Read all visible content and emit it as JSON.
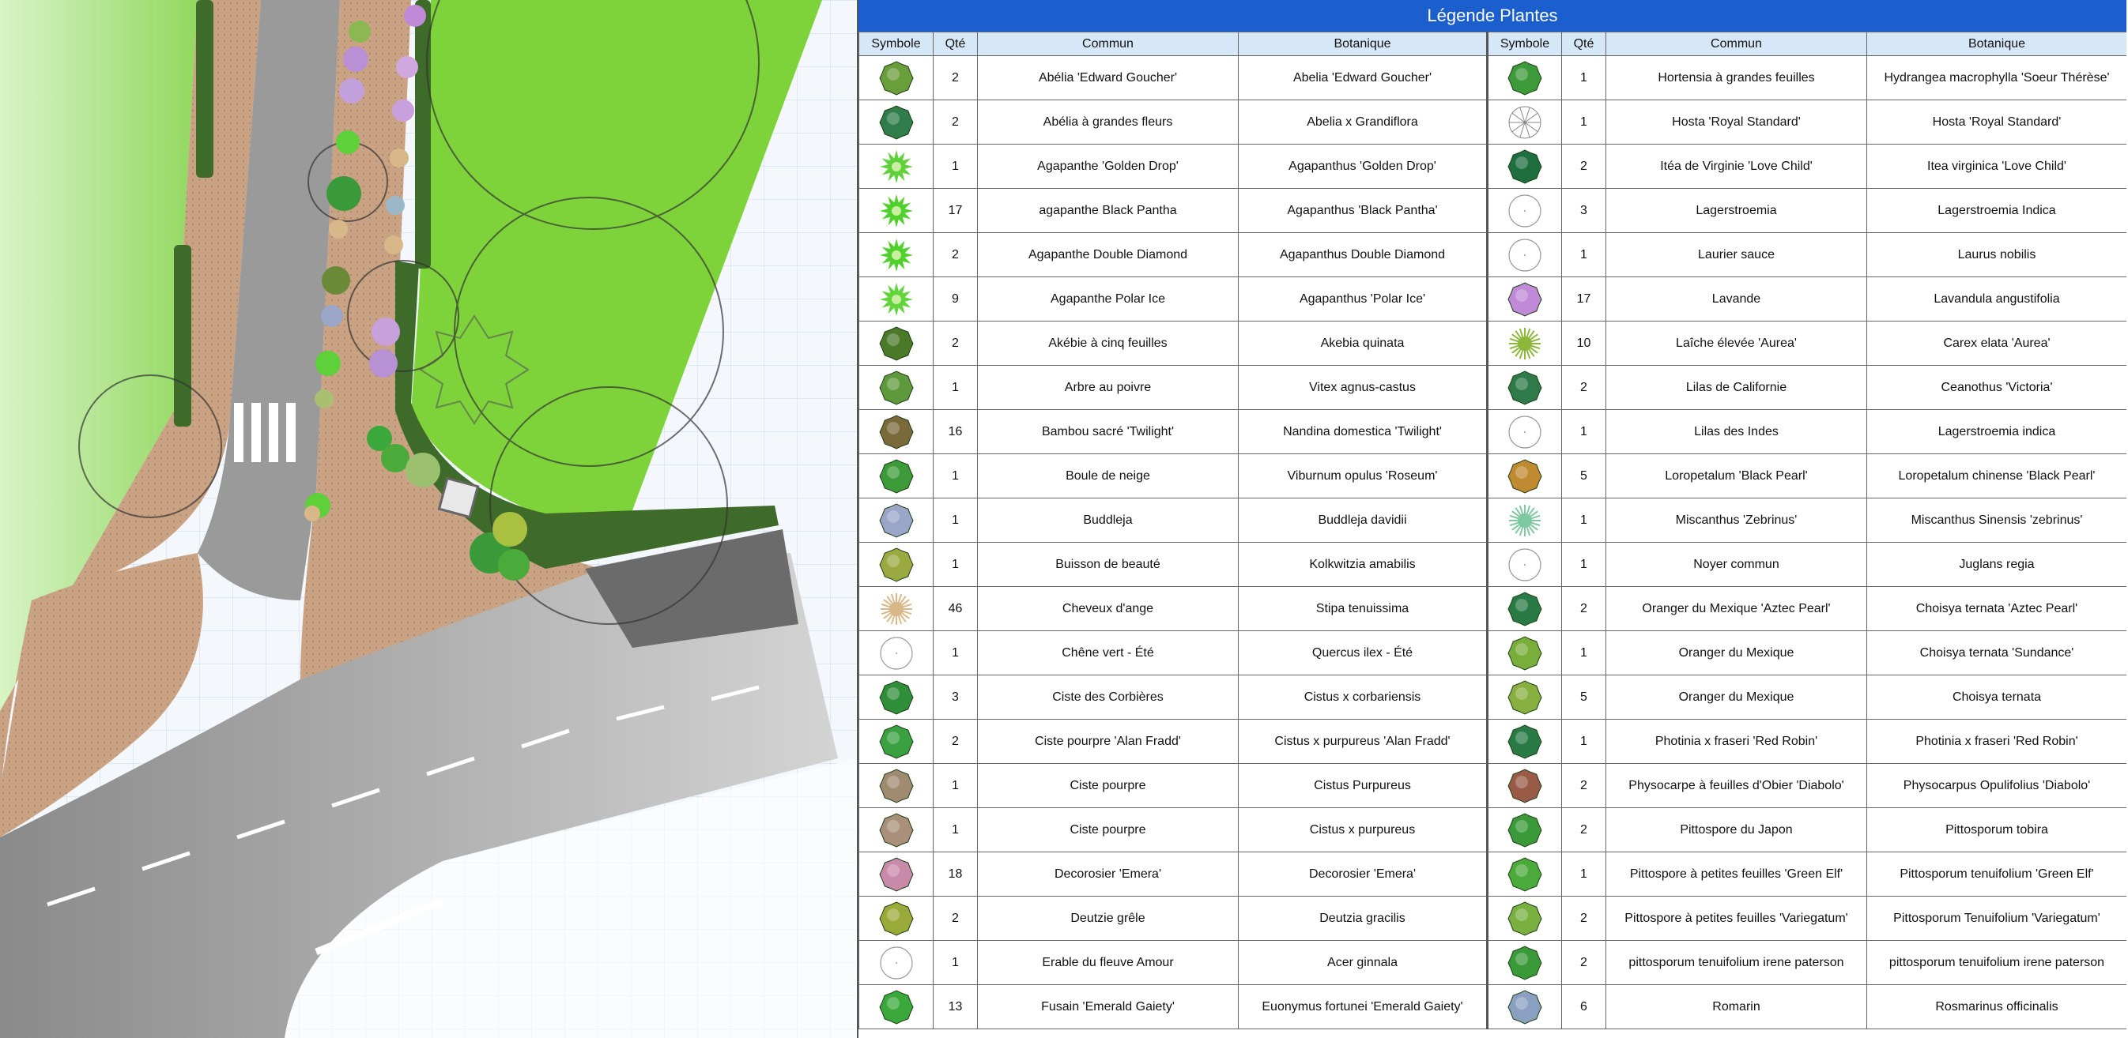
{
  "legend": {
    "title": "Légende Plantes",
    "headers": [
      "Symbole",
      "Qté",
      "Commun",
      "Botanique",
      "Symbole",
      "Qté",
      "Commun",
      "Botanique"
    ],
    "rows": [
      {
        "left": {
          "qty": "2",
          "common": "Abélia 'Edward Goucher'",
          "botanical": "Abelia 'Edward Goucher'",
          "icon": "shrub-icon",
          "color": "#6a9e3a"
        },
        "right": {
          "qty": "1",
          "common": "Hortensia à grandes feuilles",
          "botanical": "Hydrangea macrophylla 'Soeur Thérèse'",
          "icon": "shrub-icon",
          "color": "#3d9a3a"
        }
      },
      {
        "left": {
          "qty": "2",
          "common": "Abélia à grandes fleurs",
          "botanical": "Abelia x Grandiflora",
          "icon": "shrub-icon",
          "color": "#2e7d4a"
        },
        "right": {
          "qty": "1",
          "common": "Hosta 'Royal Standard'",
          "botanical": "Hosta 'Royal Standard'",
          "icon": "star-outline-icon",
          "color": "#888888"
        }
      },
      {
        "left": {
          "qty": "1",
          "common": "Agapanthe 'Golden Drop'",
          "botanical": "Agapanthus 'Golden Drop'",
          "icon": "spiky-plant-icon",
          "color": "#5fd13a"
        },
        "right": {
          "qty": "2",
          "common": "Itéa de Virginie 'Love Child'",
          "botanical": "Itea virginica 'Love Child'",
          "icon": "shrub-icon",
          "color": "#1f6e40"
        }
      },
      {
        "left": {
          "qty": "17",
          "common": "agapanthe Black Pantha",
          "botanical": "Agapanthus 'Black Pantha'",
          "icon": "spiky-plant-icon",
          "color": "#4fd02a"
        },
        "right": {
          "qty": "3",
          "common": "Lagerstroemia",
          "botanical": "Lagerstroemia Indica",
          "icon": "tree-outline-icon",
          "color": "#999999"
        }
      },
      {
        "left": {
          "qty": "2",
          "common": "Agapanthe Double Diamond",
          "botanical": "Agapanthus Double Diamond",
          "icon": "spiky-plant-icon",
          "color": "#4fd02a"
        },
        "right": {
          "qty": "1",
          "common": "Laurier sauce",
          "botanical": "Laurus nobilis",
          "icon": "tree-outline-icon",
          "color": "#999999"
        }
      },
      {
        "left": {
          "qty": "9",
          "common": "Agapanthe Polar Ice",
          "botanical": "Agapanthus 'Polar Ice'",
          "icon": "spiky-plant-icon",
          "color": "#62d43c"
        },
        "right": {
          "qty": "17",
          "common": "Lavande",
          "botanical": "Lavandula angustifolia",
          "icon": "shrub-icon",
          "color": "#c08ad8"
        }
      },
      {
        "left": {
          "qty": "2",
          "common": "Akébie à cinq feuilles",
          "botanical": "Akebia quinata",
          "icon": "shrub-icon",
          "color": "#4a7a28"
        },
        "right": {
          "qty": "10",
          "common": "Laîche élevée 'Aurea'",
          "botanical": "Carex elata 'Aurea'",
          "icon": "grass-icon",
          "color": "#8cb83a"
        }
      },
      {
        "left": {
          "qty": "1",
          "common": "Arbre au poivre",
          "botanical": "Vitex agnus-castus",
          "icon": "shrub-icon",
          "color": "#5e9a3c"
        },
        "right": {
          "qty": "2",
          "common": "Lilas de Californie",
          "botanical": "Ceanothus 'Victoria'",
          "icon": "shrub-icon",
          "color": "#2e7a48"
        }
      },
      {
        "left": {
          "qty": "16",
          "common": "Bambou sacré 'Twilight'",
          "botanical": "Nandina domestica 'Twilight'",
          "icon": "shrub-icon",
          "color": "#7a6a3a"
        },
        "right": {
          "qty": "1",
          "common": "Lilas des Indes",
          "botanical": "Lagerstroemia indica",
          "icon": "tree-outline-icon",
          "color": "#999999"
        }
      },
      {
        "left": {
          "qty": "1",
          "common": "Boule de neige",
          "botanical": "Viburnum opulus 'Roseum'",
          "icon": "shrub-icon",
          "color": "#3c9a38"
        },
        "right": {
          "qty": "5",
          "common": "Loropetalum 'Black Pearl'",
          "botanical": "Loropetalum chinense 'Black Pearl'",
          "icon": "shrub-icon",
          "color": "#c08a30"
        }
      },
      {
        "left": {
          "qty": "1",
          "common": "Buddleja",
          "botanical": "Buddleja davidii",
          "icon": "shrub-icon",
          "color": "#9aa6c8"
        },
        "right": {
          "qty": "1",
          "common": "Miscanthus 'Zebrinus'",
          "botanical": "Miscanthus Sinensis 'zebrinus'",
          "icon": "grass-icon",
          "color": "#7ec8a0"
        }
      },
      {
        "left": {
          "qty": "1",
          "common": "Buisson de beauté",
          "botanical": "Kolkwitzia amabilis",
          "icon": "shrub-icon",
          "color": "#9aaa40"
        },
        "right": {
          "qty": "1",
          "common": "Noyer commun",
          "botanical": "Juglans regia",
          "icon": "tree-outline-icon",
          "color": "#999999"
        }
      },
      {
        "left": {
          "qty": "46",
          "common": "Cheveux d'ange",
          "botanical": "Stipa tenuissima",
          "icon": "grass-icon",
          "color": "#d8b888"
        },
        "right": {
          "qty": "2",
          "common": "Oranger du Mexique 'Aztec Pearl'",
          "botanical": "Choisya ternata 'Aztec Pearl'",
          "icon": "shrub-icon",
          "color": "#2a7a46"
        }
      },
      {
        "left": {
          "qty": "1",
          "common": "Chêne vert - Été",
          "botanical": "Quercus ilex - Été",
          "icon": "tree-outline-icon",
          "color": "#999999"
        },
        "right": {
          "qty": "1",
          "common": "Oranger du Mexique",
          "botanical": "Choisya ternata 'Sundance'",
          "icon": "shrub-icon",
          "color": "#7aae3a"
        }
      },
      {
        "left": {
          "qty": "3",
          "common": "Ciste des Corbières",
          "botanical": "Cistus x corbariensis",
          "icon": "shrub-icon",
          "color": "#2f8e3a"
        },
        "right": {
          "qty": "5",
          "common": "Oranger du Mexique",
          "botanical": "Choisya ternata",
          "icon": "shrub-icon",
          "color": "#88b040"
        }
      },
      {
        "left": {
          "qty": "2",
          "common": "Ciste pourpre 'Alan Fradd'",
          "botanical": "Cistus x purpureus 'Alan Fradd'",
          "icon": "shrub-icon",
          "color": "#3aa040"
        },
        "right": {
          "qty": "1",
          "common": "Photinia x fraseri 'Red Robin'",
          "botanical": "Photinia x fraseri 'Red Robin'",
          "icon": "shrub-icon",
          "color": "#2a7a46"
        }
      },
      {
        "left": {
          "qty": "1",
          "common": "Ciste pourpre",
          "botanical": "Cistus Purpureus",
          "icon": "shrub-icon",
          "color": "#a08a70"
        },
        "right": {
          "qty": "2",
          "common": "Physocarpe à feuilles d'Obier 'Diabolo'",
          "botanical": "Physocarpus Opulifolius 'Diabolo'",
          "icon": "shrub-icon",
          "color": "#9a5a48"
        }
      },
      {
        "left": {
          "qty": "1",
          "common": "Ciste pourpre",
          "botanical": "Cistus x purpureus",
          "icon": "shrub-icon",
          "color": "#a8907a"
        },
        "right": {
          "qty": "2",
          "common": "Pittospore du Japon",
          "botanical": "Pittosporum tobira",
          "icon": "shrub-icon",
          "color": "#3a9a3a"
        }
      },
      {
        "left": {
          "qty": "18",
          "common": "Decorosier 'Emera'",
          "botanical": "Decorosier 'Emera'",
          "icon": "shrub-icon",
          "color": "#c88aa8"
        },
        "right": {
          "qty": "1",
          "common": "Pittospore à petites feuilles 'Green Elf'",
          "botanical": "Pittosporum tenuifolium 'Green Elf'",
          "icon": "shrub-icon",
          "color": "#4aaa3a"
        }
      },
      {
        "left": {
          "qty": "2",
          "common": "Deutzie grêle",
          "botanical": "Deutzia gracilis",
          "icon": "shrub-icon",
          "color": "#9aaa38"
        },
        "right": {
          "qty": "2",
          "common": "Pittospore à petites feuilles 'Variegatum'",
          "botanical": "Pittosporum Tenuifolium 'Variegatum'",
          "icon": "shrub-icon",
          "color": "#7ab040"
        }
      },
      {
        "left": {
          "qty": "1",
          "common": "Erable du fleuve Amour",
          "botanical": "Acer ginnala",
          "icon": "tree-outline-icon",
          "color": "#999999"
        },
        "right": {
          "qty": "2",
          "common": "pittosporum tenuifolium irene paterson",
          "botanical": "pittosporum tenuifolium irene paterson",
          "icon": "shrub-icon",
          "color": "#3a9a3a"
        }
      },
      {
        "left": {
          "qty": "13",
          "common": "Fusain 'Emerald Gaiety'",
          "botanical": "Euonymus fortunei 'Emerald Gaiety'",
          "icon": "shrub-icon",
          "color": "#3aa83a"
        },
        "right": {
          "qty": "6",
          "common": "Romarin",
          "botanical": "Rosmarinus officinalis",
          "icon": "shrub-icon",
          "color": "#8aa0c0"
        }
      }
    ]
  },
  "plan": {
    "colors": {
      "lawn": "#7ed33a",
      "lawn_light": "#c8eeb0",
      "paving": "#c9a383",
      "road": "#9a9a9a",
      "road_light": "#c8c8c8",
      "hedge": "#3e6a2a",
      "parking": "#6b6b6b",
      "grid": "#c9d9ec"
    }
  }
}
